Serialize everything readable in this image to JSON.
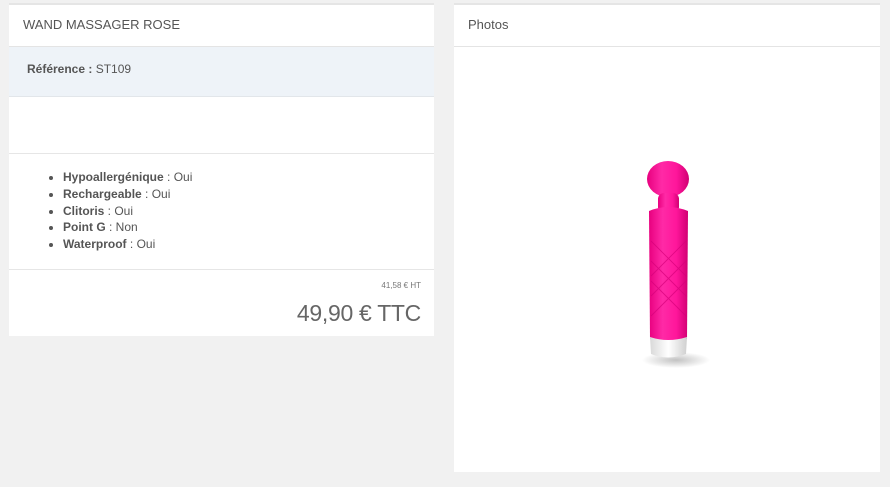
{
  "product": {
    "title": "WAND MASSAGER ROSE",
    "reference_label": "Référence :",
    "reference_value": "ST109",
    "features": [
      {
        "label": "Hypoallergénique",
        "value": " : Oui"
      },
      {
        "label": "Rechargeable",
        "value": " : Oui"
      },
      {
        "label": "Clitoris",
        "value": " : Oui"
      },
      {
        "label": "Point G",
        "value": " : Non"
      },
      {
        "label": "Waterproof",
        "value": " : Oui"
      }
    ],
    "price_ht": "41,58 € HT",
    "price_ttc": "49,90 € TTC"
  },
  "photos": {
    "title": "Photos",
    "image_color": "#ff1a9e"
  }
}
